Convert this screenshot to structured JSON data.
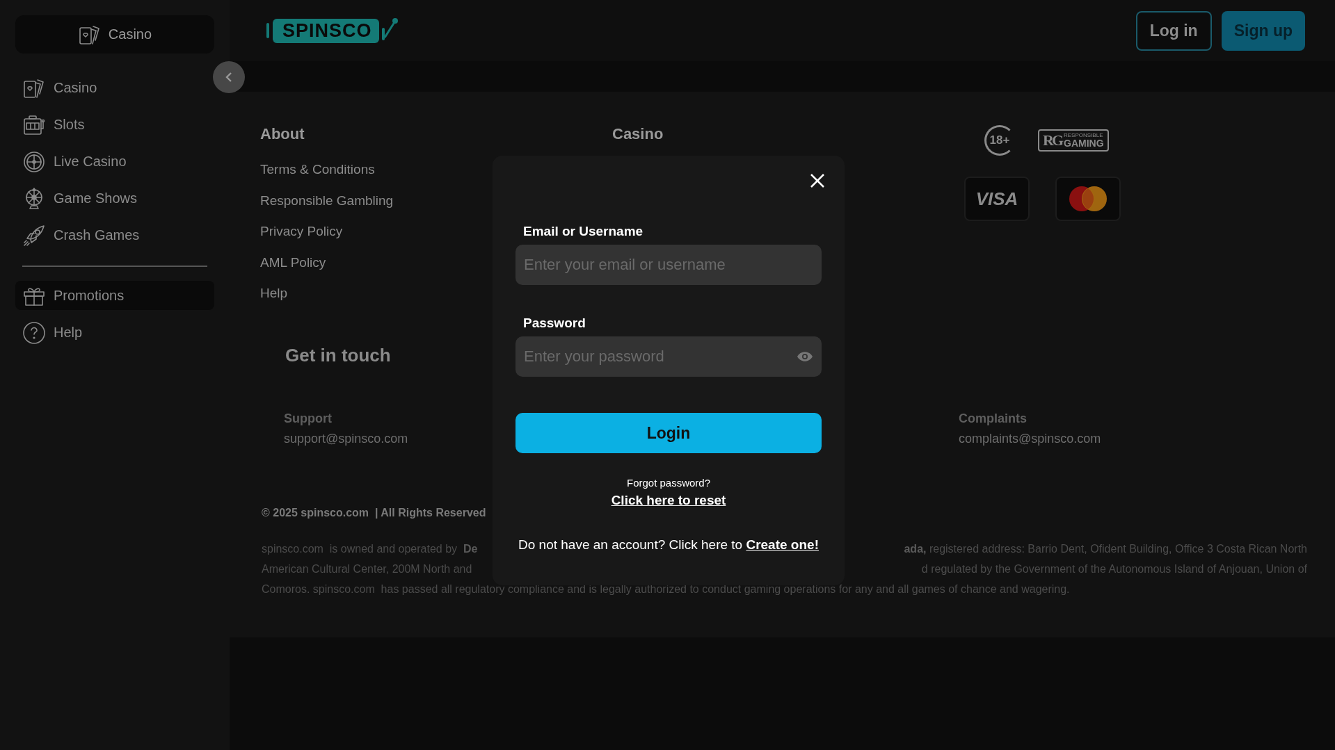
{
  "sidebar": {
    "top_button": "Casino",
    "items": [
      {
        "label": "Casino",
        "selected": false
      },
      {
        "label": "Slots",
        "selected": false
      },
      {
        "label": "Live Casino",
        "selected": false
      },
      {
        "label": "Game Shows",
        "selected": false
      },
      {
        "label": "Crash Games",
        "selected": false
      }
    ],
    "secondary_items": [
      {
        "label": "Promotions",
        "selected": true
      },
      {
        "label": "Help",
        "selected": false
      }
    ]
  },
  "header": {
    "logo": "SPINSCO",
    "buttons": [
      {
        "label": "Log in",
        "kind": "outline"
      },
      {
        "label": "Sign up",
        "kind": "filled"
      }
    ]
  },
  "footer": {
    "columns": [
      {
        "heading": "About",
        "links": [
          "Terms & Conditions",
          "Responsible Gambling",
          "Privacy Policy",
          "AML Policy",
          "Help"
        ]
      },
      {
        "heading": "Casino"
      }
    ],
    "trust_badges": [
      {
        "kind": "age",
        "text": "18+"
      },
      {
        "kind": "rg",
        "mark": "RG",
        "lines": [
          "RESPONSIBLE",
          "GAMING"
        ]
      }
    ],
    "payment_cards": [
      {
        "kind": "visa",
        "text": "VISA"
      },
      {
        "kind": "mastercard"
      }
    ],
    "contact": {
      "heading": "Get in touch",
      "items": [
        {
          "label": "Support",
          "email": "support@spinsco.com"
        },
        {
          "label": "Complaints",
          "email": "complaints@spinsco.com"
        }
      ]
    },
    "copyright": "© 2025 spinsco.com  | All Rights Reserved",
    "legal_lines": [
      [
        "spinsco.com  is owned and operated by  **De**",
        "**ada,** registered address: Barrio Dent, Ofident Building, Office 3 Costa Rican North"
      ],
      [
        "American Cultural Center, 200M North and",
        "d regulated by the Government of the Autonomous Island of Anjouan, Union of"
      ],
      [
        "Comoros. spinsco.com  has passed all regulatory compliance and is legally authorized to conduct gaming operations for any and all games of chance and wagering."
      ]
    ]
  },
  "login_modal": {
    "email_label": "Email or Username",
    "email_placeholder": "Enter your email or username",
    "password_label": "Password",
    "password_placeholder": "Enter your password",
    "submit": "Login",
    "forgot": "Forgot password?",
    "reset_link": "Click here to reset",
    "signup_text": "Do not have an account? Click here to",
    "signup_link": "Create one!"
  }
}
